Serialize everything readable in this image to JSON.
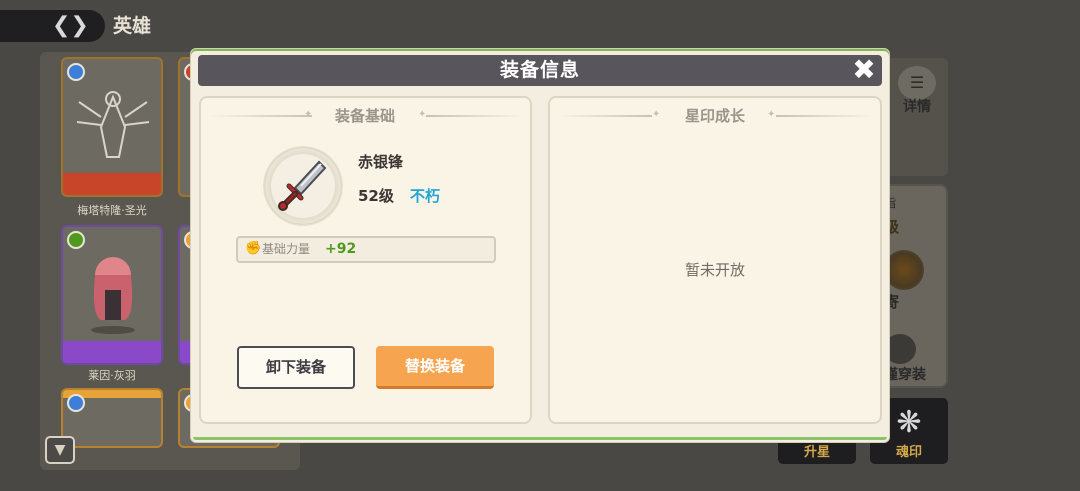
{
  "background": {
    "page_title": "英雄",
    "heroes": [
      {
        "name": "梅塔特隆·圣光"
      },
      {
        "name": "莱因·灰羽"
      }
    ],
    "detail_label": "详情",
    "side_panel": {
      "line1": "指",
      "line2": "级",
      "line3": "寄",
      "line4": "谨穿装"
    },
    "bottom_buttons": [
      {
        "label": "升星"
      },
      {
        "label": "魂印"
      }
    ],
    "colors": {
      "rank_ssr": "#c8452a",
      "rank_sr": "#8a49c8",
      "rank_r": "#e8a23a"
    }
  },
  "dialog": {
    "title": "装备信息",
    "left_section": {
      "title": "装备基础",
      "item_name": "赤银锋",
      "item_level": "52级",
      "item_tier": "不朽",
      "stat_label": "基础力量",
      "stat_value": "+92",
      "unequip_label": "卸下装备",
      "replace_label": "替换装备"
    },
    "right_section": {
      "title": "星印成长",
      "empty_text": "暂未开放"
    },
    "colors": {
      "header": "#58565c",
      "tier": "#22a6d8",
      "stat_value": "#4f9a1e",
      "replace_button": "#f6a450"
    }
  }
}
